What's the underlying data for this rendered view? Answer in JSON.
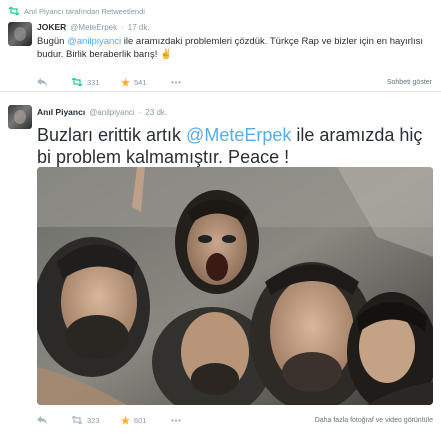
{
  "tweet1": {
    "retweet_label": "Anıl Piyancı tarafından Retweetlendi",
    "author_name": "JOKER",
    "author_handle": "@MeteErpek",
    "time": "17 dk.",
    "text_parts": {
      "p1": "Bugün ",
      "mention": "@anilpiyanci",
      "p2": " ile aramızdaki problemleri çözdük. Türkçe Rap ve bizler için en hayırlısı budur. Birlik beraberlik barış! ✌"
    },
    "retweet_count": "331",
    "favorite_count": "541",
    "conversation_link": "Sohbeti göster",
    "colors": {
      "retweet_active": "#19cf86",
      "favorite_active": "#ffac33"
    }
  },
  "tweet2": {
    "author_name": "Anıl Piyancı",
    "author_handle": "@anilpiyanci",
    "time": "23 dk.",
    "text_parts": {
      "p1": "Buzları erittik artık ",
      "mention": "@MeteErpek",
      "p2": " ile aramızda hiç bi problem kalmamıştır. Peace !"
    },
    "retweet_count": "323",
    "favorite_count": "601",
    "more_media_link": "Daha fazla fotoğraf ve video görüntüle",
    "colors": {
      "retweet_active": "#19cf86",
      "favorite_active": "#ffac33",
      "link": "#55acee"
    }
  },
  "icons": {
    "retweet": "retweet-icon",
    "reply": "reply-icon",
    "favorite": "star-icon",
    "more": "more-dots-icon"
  }
}
